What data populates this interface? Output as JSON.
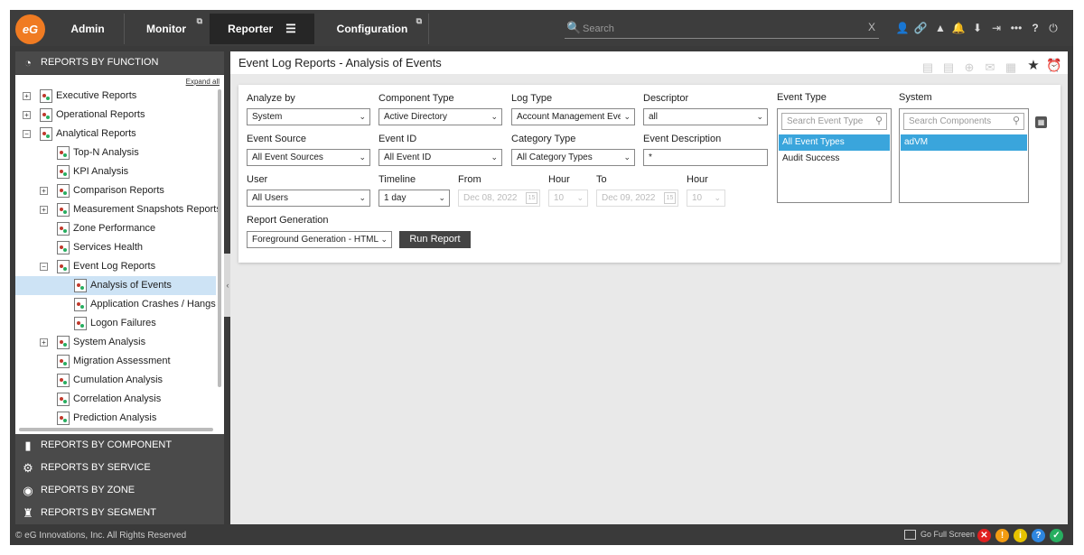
{
  "logo": {
    "text": "eG"
  },
  "nav": {
    "tabs": [
      {
        "label": "Admin"
      },
      {
        "label": "Monitor"
      },
      {
        "label": "Reporter"
      },
      {
        "label": "Configuration"
      }
    ],
    "ext_glyph": "⧉",
    "burger_glyph": "☰"
  },
  "search": {
    "placeholder": "Search",
    "clear": "X",
    "icon": "🔍"
  },
  "toolbar_icons": [
    {
      "name": "user-icon",
      "glyph": "👤"
    },
    {
      "name": "link-icon",
      "glyph": "🔗"
    },
    {
      "name": "chart-icon",
      "glyph": "▲"
    },
    {
      "name": "bell-icon",
      "glyph": "🔔"
    },
    {
      "name": "download-icon",
      "glyph": "⬇"
    },
    {
      "name": "signin-icon",
      "glyph": "⇥"
    },
    {
      "name": "more-icon",
      "glyph": "•••"
    },
    {
      "name": "help-icon",
      "glyph": "?"
    },
    {
      "name": "power-icon",
      "glyph": "⏻"
    }
  ],
  "sidebar": {
    "reports_by_function": "REPORTS BY FUNCTION",
    "expand_all": "Expand all",
    "tree": [
      {
        "label": "Executive Reports",
        "pm": "+"
      },
      {
        "label": "Operational Reports",
        "pm": "+"
      },
      {
        "label": "Analytical Reports",
        "pm": "−"
      },
      {
        "label": "Top-N Analysis"
      },
      {
        "label": "KPI Analysis"
      },
      {
        "label": "Comparison Reports",
        "pm": "+"
      },
      {
        "label": "Measurement Snapshots Reports",
        "pm": "+"
      },
      {
        "label": "Zone Performance"
      },
      {
        "label": "Services Health"
      },
      {
        "label": "Event Log Reports",
        "pm": "−"
      },
      {
        "label": "Analysis of Events"
      },
      {
        "label": "Application Crashes / Hangs"
      },
      {
        "label": "Logon Failures"
      },
      {
        "label": "System Analysis",
        "pm": "+"
      },
      {
        "label": "Migration Assessment"
      },
      {
        "label": "Cumulation Analysis"
      },
      {
        "label": "Correlation Analysis"
      },
      {
        "label": "Prediction Analysis"
      }
    ],
    "sections": [
      {
        "label": "REPORTS BY COMPONENT",
        "glyph": "▮"
      },
      {
        "label": "REPORTS BY SERVICE",
        "glyph": "⚙"
      },
      {
        "label": "REPORTS BY ZONE",
        "glyph": "◉"
      },
      {
        "label": "REPORTS BY SEGMENT",
        "glyph": "♜"
      }
    ],
    "collapse_glyph": "‹"
  },
  "main": {
    "title": "Event Log Reports - Analysis of Events",
    "action_icons": [
      {
        "name": "pdf-icon",
        "glyph": "▤"
      },
      {
        "name": "export-icon",
        "glyph": "▤"
      },
      {
        "name": "zoom-icon",
        "glyph": "⊕"
      },
      {
        "name": "mail-icon",
        "glyph": "✉"
      },
      {
        "name": "excel-icon",
        "glyph": "▦"
      },
      {
        "name": "star-icon",
        "glyph": "★"
      },
      {
        "name": "alarm-icon",
        "glyph": "⏰"
      }
    ]
  },
  "form": {
    "analyze_by": {
      "label": "Analyze by",
      "value": "System"
    },
    "component_type": {
      "label": "Component Type",
      "value": "Active Directory"
    },
    "log_type": {
      "label": "Log Type",
      "value": "Account Management Eve"
    },
    "descriptor": {
      "label": "Descriptor",
      "value": "all"
    },
    "event_source": {
      "label": "Event Source",
      "value": "All Event Sources"
    },
    "event_id": {
      "label": "Event ID",
      "value": "All Event ID"
    },
    "category_type": {
      "label": "Category Type",
      "value": "All Category Types"
    },
    "event_description": {
      "label": "Event Description",
      "value": "*"
    },
    "user": {
      "label": "User",
      "value": "All Users"
    },
    "timeline": {
      "label": "Timeline",
      "value": "1 day"
    },
    "from": {
      "label": "From",
      "value": "Dec 08, 2022"
    },
    "hour_from": {
      "label": "Hour",
      "value": "10"
    },
    "to": {
      "label": "To",
      "value": "Dec 09, 2022"
    },
    "hour_to": {
      "label": "Hour",
      "value": "10"
    },
    "report_generation": {
      "label": "Report Generation",
      "value": "Foreground Generation - HTML"
    },
    "run_label": "Run Report",
    "chevron": "⌄",
    "cal_glyph": "15",
    "event_type": {
      "label": "Event Type",
      "search_placeholder": "Search Event Type",
      "items": [
        "All Event Types",
        "Audit Success"
      ]
    },
    "system": {
      "label": "System",
      "search_placeholder": "Search Components",
      "items": [
        "adVM"
      ]
    },
    "mag_glyph": "⚲",
    "calc_glyph": "▦"
  },
  "footer": {
    "copyright": "© eG Innovations, Inc. All Rights Reserved",
    "full_screen": "Go Full Screen",
    "status": [
      {
        "name": "critical-status-icon",
        "glyph": "✕",
        "color": "#e02020"
      },
      {
        "name": "major-status-icon",
        "glyph": "!",
        "color": "#f39c12"
      },
      {
        "name": "minor-status-icon",
        "glyph": "i",
        "color": "#e6c200"
      },
      {
        "name": "info-status-icon",
        "glyph": "?",
        "color": "#2e86de"
      },
      {
        "name": "normal-status-icon",
        "glyph": "✓",
        "color": "#27ae60"
      }
    ]
  }
}
